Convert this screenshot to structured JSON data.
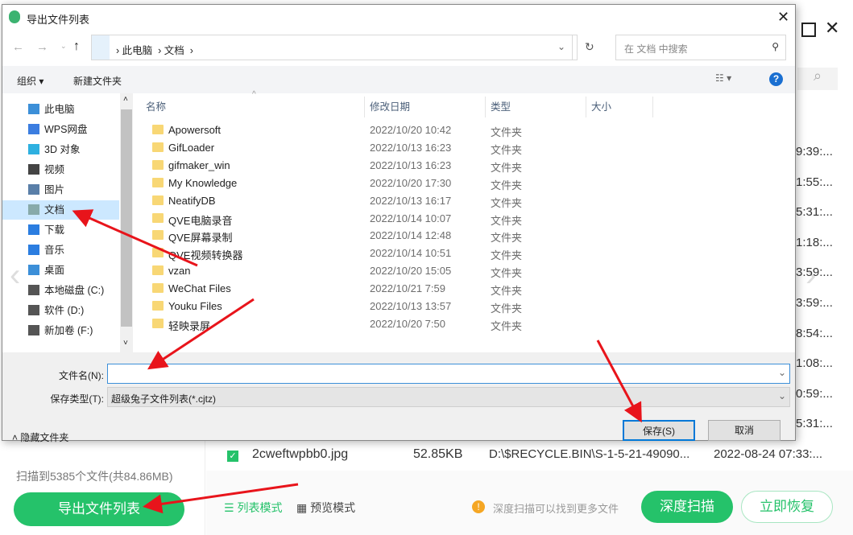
{
  "dialog": {
    "title": "导出文件列表",
    "breadcrumb": [
      "此电脑",
      "文档"
    ],
    "search_placeholder": "在 文档 中搜索",
    "organize": "组织 ▾",
    "new_folder": "新建文件夹",
    "nav_items": [
      {
        "label": "此电脑",
        "icon": "computer-icon",
        "color": "#3c8fd8"
      },
      {
        "label": "WPS网盘",
        "icon": "cloud-icon",
        "color": "#3b7de0"
      },
      {
        "label": "3D 对象",
        "icon": "cube-icon",
        "color": "#2eb0e0"
      },
      {
        "label": "视频",
        "icon": "video-icon",
        "color": "#444"
      },
      {
        "label": "图片",
        "icon": "picture-icon",
        "color": "#5a7fa8"
      },
      {
        "label": "文档",
        "icon": "document-icon",
        "color": "#8aa"
      },
      {
        "label": "下载",
        "icon": "download-icon",
        "color": "#2b7de0"
      },
      {
        "label": "音乐",
        "icon": "music-icon",
        "color": "#2b7de0"
      },
      {
        "label": "桌面",
        "icon": "desktop-icon",
        "color": "#3c8fd8"
      },
      {
        "label": "本地磁盘 (C:)",
        "icon": "drive-icon",
        "color": "#555"
      },
      {
        "label": "软件 (D:)",
        "icon": "drive-icon",
        "color": "#555"
      },
      {
        "label": "新加卷 (F:)",
        "icon": "drive-icon",
        "color": "#555"
      }
    ],
    "columns": [
      "名称",
      "修改日期",
      "类型",
      "大小"
    ],
    "files": [
      [
        "Apowersoft",
        "2022/10/20 10:42",
        "文件夹"
      ],
      [
        "GifLoader",
        "2022/10/13 16:23",
        "文件夹"
      ],
      [
        "gifmaker_win",
        "2022/10/13 16:23",
        "文件夹"
      ],
      [
        "My Knowledge",
        "2022/10/20 17:30",
        "文件夹"
      ],
      [
        "NeatifyDB",
        "2022/10/13 16:17",
        "文件夹"
      ],
      [
        "QVE电脑录音",
        "2022/10/14 10:07",
        "文件夹"
      ],
      [
        "QVE屏幕录制",
        "2022/10/14 12:48",
        "文件夹"
      ],
      [
        "QVE视频转换器",
        "2022/10/14 10:51",
        "文件夹"
      ],
      [
        "vzan",
        "2022/10/20 15:05",
        "文件夹"
      ],
      [
        "WeChat Files",
        "2022/10/21 7:59",
        "文件夹"
      ],
      [
        "Youku Files",
        "2022/10/13 13:57",
        "文件夹"
      ],
      [
        "轻映录屏",
        "2022/10/20 7:50",
        "文件夹"
      ]
    ],
    "filename_label": "文件名(N):",
    "filename_value": "",
    "filetype_label": "保存类型(T):",
    "filetype_value": "超级兔子文件列表(*.cjtz)",
    "hide_folders": "隐藏文件夹",
    "save": "保存(S)",
    "cancel": "取消"
  },
  "app": {
    "times": [
      "9:39:...",
      "1:55:...",
      "5:31:...",
      "1:18:...",
      "3:59:...",
      "3:59:...",
      "8:54:...",
      "1:08:...",
      "0:59:...",
      "5:31:..."
    ],
    "file_row": {
      "name": "2cweftwpbb0.jpg",
      "size": "52.85KB",
      "path": "D:\\$RECYCLE.BIN\\S-1-5-21-49090...",
      "time": "2022-08-24 07:33:..."
    },
    "scan_info": "扫描到5385个文件(共84.86MB)",
    "export_button": "导出文件列表",
    "list_mode": "列表模式",
    "preview_mode": "预览模式",
    "hint": "深度扫描可以找到更多文件",
    "deep_scan": "深度扫描",
    "recover": "立即恢复",
    "accent": "#25c26a"
  }
}
